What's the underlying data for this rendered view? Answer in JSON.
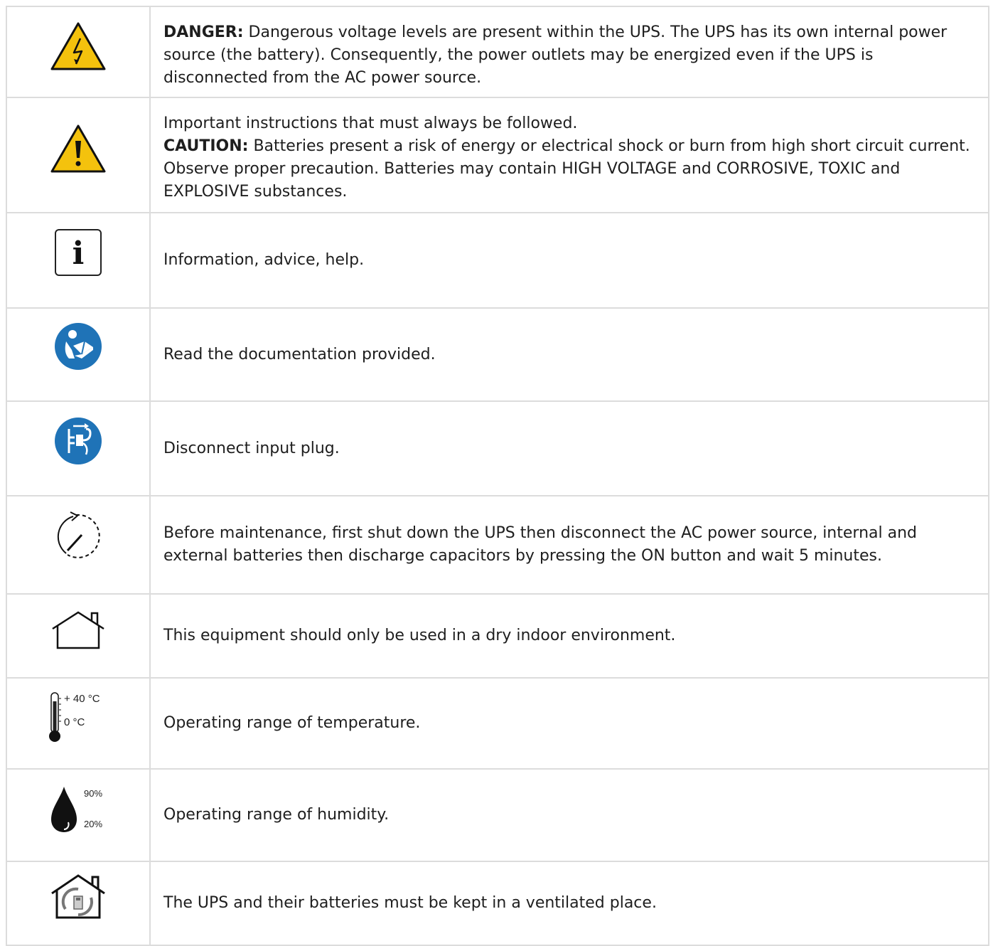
{
  "colors": {
    "warning_yellow": "#f4c20d",
    "sign_blue": "#1f73b7",
    "border": "#dcdcdc"
  },
  "rows": [
    {
      "icon": "high-voltage-warning-icon",
      "label": "DANGER:",
      "text": " Dangerous voltage levels are present within the UPS. The UPS has its own internal power source (the battery). Consequently, the power outlets may be energized even if the UPS is disconnected from the AC power source."
    },
    {
      "icon": "caution-warning-icon",
      "intro": "Important instructions that must always be followed.",
      "label": "CAUTION:",
      "text": " Batteries present a risk of energy or electrical shock or burn from high short circuit current. Observe proper precaution. Batteries may contain HIGH VOLTAGE and CORROSIVE, TOXIC and EXPLOSIVE substances."
    },
    {
      "icon": "information-icon",
      "glyph": "i",
      "text": "Information, advice, help."
    },
    {
      "icon": "read-manual-icon",
      "text": "Read the documentation provided."
    },
    {
      "icon": "disconnect-plug-icon",
      "text": "Disconnect input plug."
    },
    {
      "icon": "shutdown-wait-icon",
      "text": "Before maintenance, first shut down the UPS then disconnect the AC power source, internal and external batteries then discharge capacitors by pressing the ON button and wait 5 minutes."
    },
    {
      "icon": "indoor-house-icon",
      "text": "This equipment should only be used in a dry indoor environment."
    },
    {
      "icon": "thermometer-icon",
      "temp_max": "+ 40 °C",
      "temp_min": "0 °C",
      "text": "Operating range of temperature."
    },
    {
      "icon": "humidity-drop-icon",
      "humidity_max": "90%",
      "humidity_min": "20%",
      "text": "Operating range of humidity."
    },
    {
      "icon": "ventilated-house-icon",
      "text": "The UPS and their batteries must be kept in a ventilated place."
    }
  ]
}
